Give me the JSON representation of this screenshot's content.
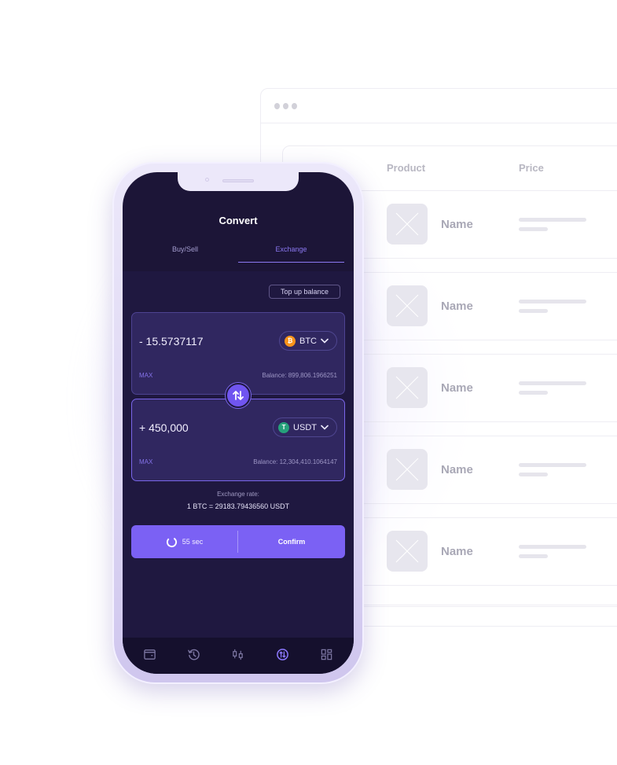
{
  "browser": {
    "table": {
      "headers": [
        "Product",
        "Price"
      ],
      "rows": [
        {
          "name": "Name"
        },
        {
          "name": "Name"
        },
        {
          "name": "Name"
        },
        {
          "name": "Name"
        },
        {
          "name": "Name"
        }
      ]
    }
  },
  "app": {
    "title": "Convert",
    "tabs": [
      {
        "label": "Buy/Sell",
        "active": false
      },
      {
        "label": "Exchange",
        "active": true
      }
    ],
    "top_up_label": "Top up balance",
    "from": {
      "amount": "- 15.5737117",
      "coin": "BTC",
      "coin_icon": "bitcoin-icon",
      "coin_color": "#f7931a",
      "max_label": "MAX",
      "balance": "Balance: 899,806.1966251"
    },
    "to": {
      "amount": "+ 450,000",
      "coin": "USDT",
      "coin_icon": "tether-icon",
      "coin_color": "#26a17b",
      "max_label": "MAX",
      "balance": "Balance: 12,304,410.1064147"
    },
    "swap_icon": "swap-arrows-icon",
    "exchange_rate_label": "Exchange rate:",
    "exchange_rate_value": "1 BTC = 29183.79436560 USDT",
    "timer_label": "55 sec",
    "confirm_label": "Confirm",
    "nav": [
      {
        "icon": "wallet-icon",
        "active": false
      },
      {
        "icon": "history-icon",
        "active": false
      },
      {
        "icon": "candlestick-icon",
        "active": false
      },
      {
        "icon": "exchange-icon",
        "active": true
      },
      {
        "icon": "dashboard-icon",
        "active": false
      }
    ],
    "colors": {
      "accent": "#7b61f4",
      "screen_bg": "#1c1537",
      "card_bg": "#302760"
    }
  }
}
